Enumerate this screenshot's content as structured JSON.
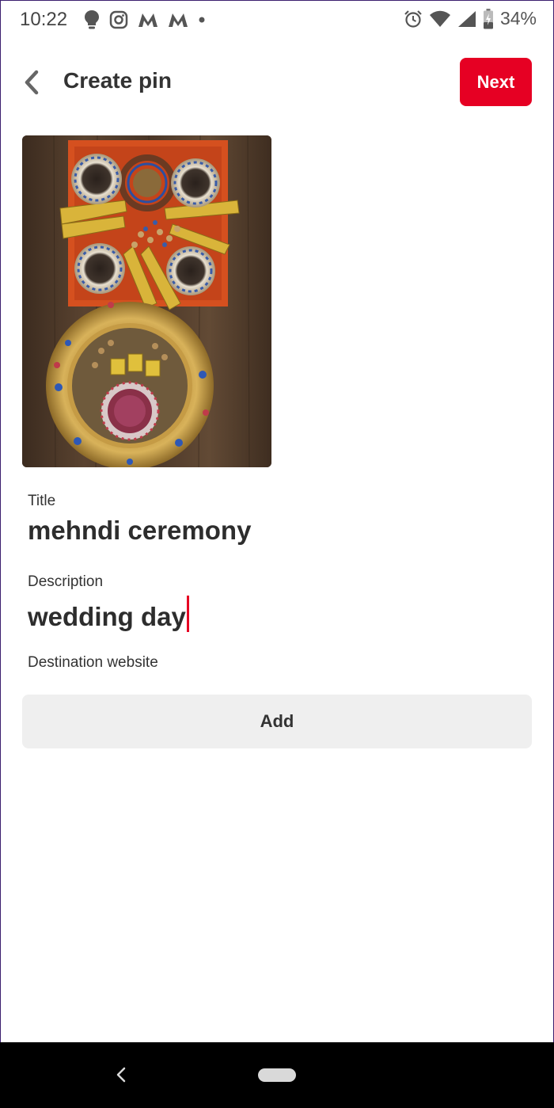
{
  "status_bar": {
    "time": "10:22",
    "battery": "34%"
  },
  "header": {
    "title": "Create pin",
    "next_label": "Next"
  },
  "pin": {
    "image_description": ""
  },
  "form": {
    "title_label": "Title",
    "title_value": "mehndi ceremony",
    "description_label": "Description",
    "description_value": "wedding day",
    "destination_label": "Destination website",
    "add_label": "Add"
  },
  "colors": {
    "accent": "#e60023",
    "add_button_bg": "#efefef",
    "nav_bar_bg": "#000000"
  },
  "icons": {
    "status_left": [
      "lightbulb-icon",
      "instagram-icon",
      "myntra-icon",
      "myntra-icon",
      "dot-icon"
    ],
    "status_right": [
      "alarm-icon",
      "wifi-icon",
      "signal-icon",
      "battery-charging-icon"
    ],
    "header": "back-arrow-icon",
    "nav": [
      "nav-back-icon",
      "nav-home-pill"
    ]
  }
}
